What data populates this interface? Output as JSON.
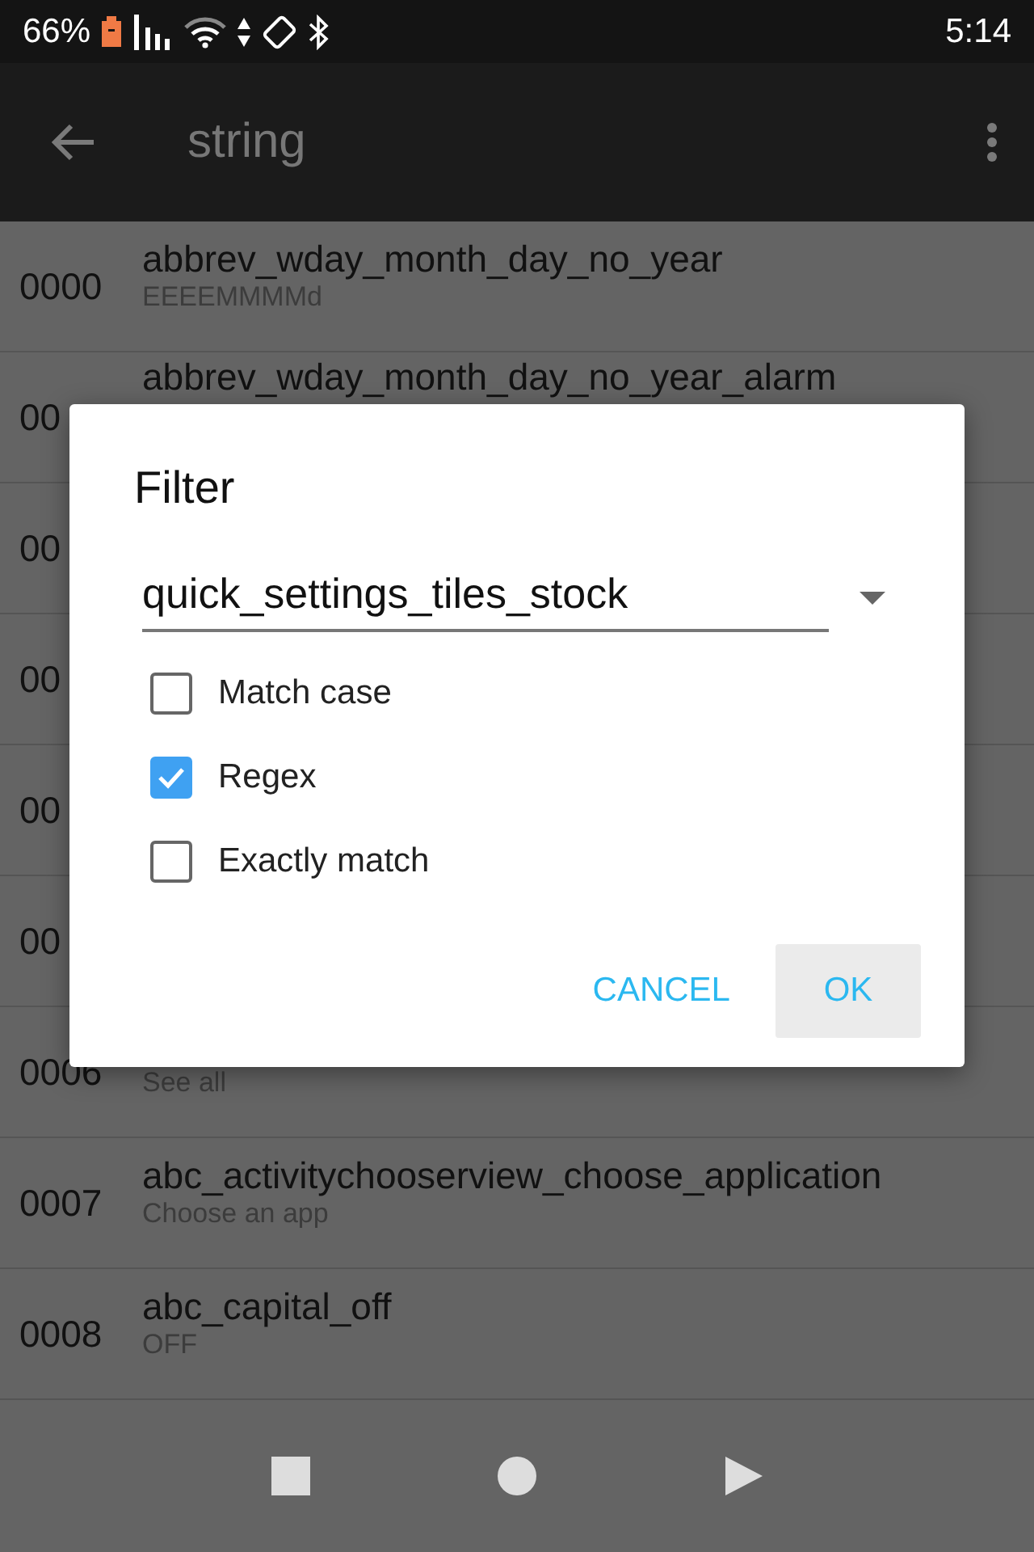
{
  "status_bar": {
    "battery": "66%",
    "time": "5:14"
  },
  "app_bar": {
    "title": "string"
  },
  "rows": [
    {
      "number": "0000",
      "name": "abbrev_wday_month_day_no_year",
      "value": "EEEEMMMMd"
    },
    {
      "number": "00",
      "name": "abbrev_wday_month_day_no_year_alarm"
    },
    {
      "number": "00"
    },
    {
      "number": "00"
    },
    {
      "number": "00"
    },
    {
      "number": "00"
    },
    {
      "number": "0006",
      "value": "See all"
    },
    {
      "number": "0007",
      "name": "abc_activitychooserview_choose_application",
      "value": "Choose an app"
    },
    {
      "number": "0008",
      "name": "abc_capital_off",
      "value": "OFF"
    }
  ],
  "dialog": {
    "title": "Filter",
    "field": {
      "value": "quick_settings_tiles_stock"
    },
    "options": [
      {
        "label": "Match case",
        "checked": false
      },
      {
        "label": "Regex",
        "checked": true
      },
      {
        "label": "Exactly match",
        "checked": false
      }
    ],
    "buttons": [
      {
        "label": "CANCEL",
        "kind": "text"
      },
      {
        "label": "OK",
        "kind": "filled"
      }
    ]
  }
}
